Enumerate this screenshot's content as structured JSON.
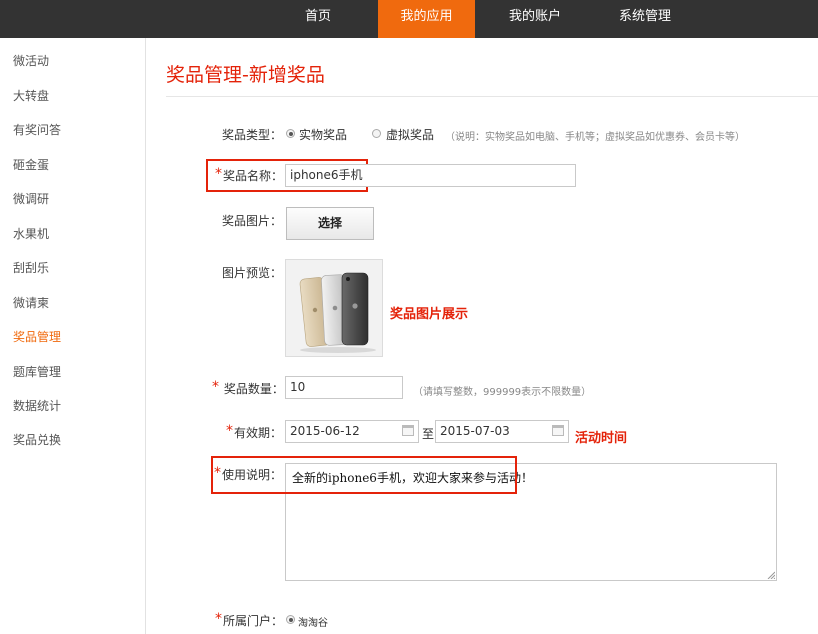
{
  "topnav": {
    "items": [
      {
        "label": "首页",
        "active": false
      },
      {
        "label": "我的应用",
        "active": true
      },
      {
        "label": "我的账户",
        "active": false
      },
      {
        "label": "系统管理",
        "active": false
      }
    ],
    "active_color": "#f06a0e",
    "bg_color": "#333333"
  },
  "sidebar": {
    "items": [
      {
        "label": "微活动"
      },
      {
        "label": "大转盘"
      },
      {
        "label": "有奖问答"
      },
      {
        "label": "砸金蛋"
      },
      {
        "label": "微调研"
      },
      {
        "label": "水果机"
      },
      {
        "label": "刮刮乐"
      },
      {
        "label": "微请柬"
      },
      {
        "label": "奖品管理",
        "active": true
      },
      {
        "label": "题库管理"
      },
      {
        "label": "数据统计"
      },
      {
        "label": "奖品兑换"
      }
    ]
  },
  "page": {
    "title": "奖品管理-新增奖品",
    "accent_color": "#e4230a"
  },
  "form": {
    "type": {
      "label": "奖品类型：",
      "options": [
        {
          "label": "实物奖品",
          "checked": true
        },
        {
          "label": "虚拟奖品",
          "checked": false
        }
      ],
      "note": "（说明：实物奖品如电脑、手机等；虚拟奖品如优惠券、会员卡等）"
    },
    "name": {
      "label": "奖品名称：",
      "value": "iphone6手机"
    },
    "image": {
      "label": "奖品图片：",
      "button_label": "选择"
    },
    "preview": {
      "label": "图片预览：",
      "callout": "奖品图片展示"
    },
    "quantity": {
      "label": "奖品数量：",
      "value": "10",
      "note": "（请填写整数，999999表示不限数量）"
    },
    "validity": {
      "label": "有效期：",
      "start": "2015-06-12",
      "separator": "至",
      "end": "2015-07-03",
      "callout": "活动时间"
    },
    "instructions": {
      "label": "使用说明：",
      "value": "全新的iphone6手机，欢迎大家来参与活动！"
    },
    "portal": {
      "label": "所属门户：",
      "option": "淘淘谷",
      "checked": true
    },
    "required_mark": "*"
  }
}
